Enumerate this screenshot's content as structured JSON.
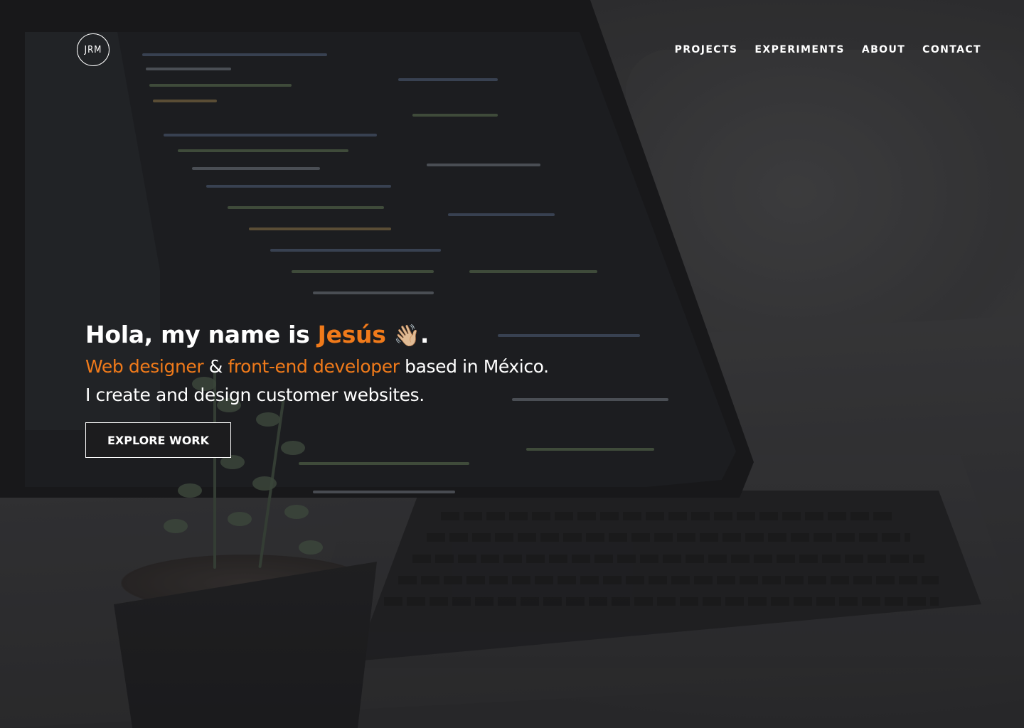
{
  "header": {
    "logo_text": "JRM",
    "nav": [
      {
        "label": "PROJECTS"
      },
      {
        "label": "EXPERIMENTS"
      },
      {
        "label": "ABOUT"
      },
      {
        "label": "CONTACT"
      }
    ]
  },
  "hero": {
    "greeting_prefix": "Hola, my name is ",
    "name": "Jesús",
    "wave_emoji": "👋🏼",
    "greeting_suffix": ".",
    "role_1": "Web designer",
    "amp": " & ",
    "role_2": "front-end developer",
    "location": " based in México.",
    "tagline": "I create and design customer websites.",
    "cta_label": "EXPLORE WORK"
  },
  "colors": {
    "accent": "#f07a1a",
    "button_bg": "#1c1c1e",
    "text": "#ffffff"
  }
}
